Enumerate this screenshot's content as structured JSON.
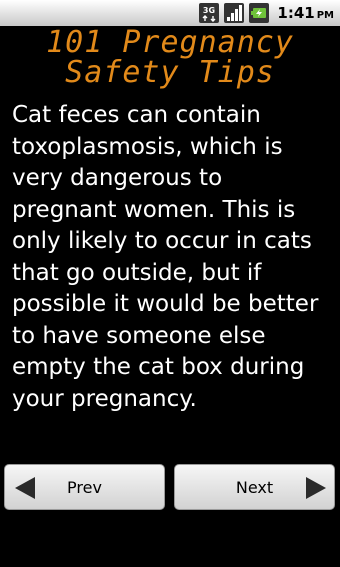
{
  "status_bar": {
    "time": "1:41",
    "ampm": "PM",
    "icons": [
      "3g-data-icon",
      "signal-icon",
      "battery-icon"
    ]
  },
  "app": {
    "title": "101 Pregnancy Safety Tips"
  },
  "tip": {
    "text": "Cat feces can contain toxoplasmosis, which is very dangerous to pregnant women.  This is only likely to occur in cats that go outside, but if possible it would be better to have someone else empty the cat box during your pregnancy."
  },
  "nav": {
    "prev_label": "Prev",
    "next_label": "Next"
  },
  "colors": {
    "title": "#e28a1a",
    "background": "#000000",
    "text": "#ffffff"
  }
}
